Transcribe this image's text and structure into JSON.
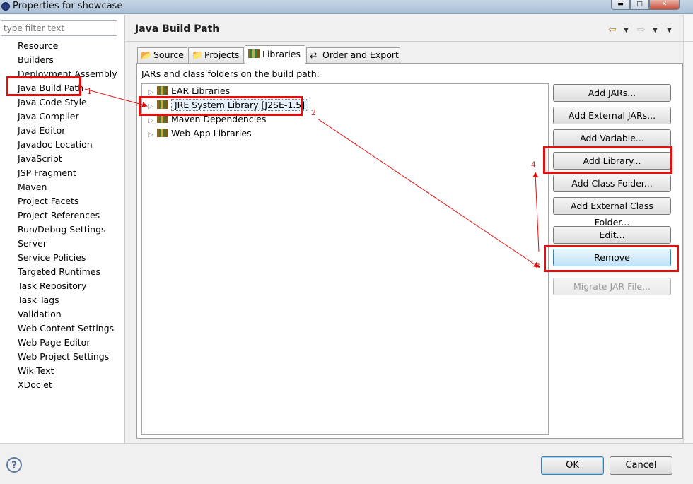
{
  "window": {
    "title": "Properties for showcase",
    "controls": [
      "minimize",
      "maximize",
      "close"
    ]
  },
  "filter": {
    "placeholder": "type filter text"
  },
  "nav_items": [
    "Resource",
    "Builders",
    "Deployment Assembly",
    "Java Build Path",
    "Java Code Style",
    "Java Compiler",
    "Java Editor",
    "Javadoc Location",
    "JavaScript",
    "JSP Fragment",
    "Maven",
    "Project Facets",
    "Project References",
    "Run/Debug Settings",
    "Server",
    "Service Policies",
    "Targeted Runtimes",
    "Task Repository",
    "Task Tags",
    "Validation",
    "Web Content Settings",
    "Web Page Editor",
    "Web Project Settings",
    "WikiText",
    "XDoclet"
  ],
  "selected_nav": "Java Build Path",
  "page_title": "Java Build Path",
  "tabs": [
    "Source",
    "Projects",
    "Libraries",
    "Order and Export"
  ],
  "active_tab": "Libraries",
  "section_label": "JARs and class folders on the build path:",
  "tree_items": [
    "EAR Libraries",
    "JRE System Library [J2SE-1.5]",
    "Maven Dependencies",
    "Web App Libraries"
  ],
  "selected_tree_item": "JRE System Library [J2SE-1.5]",
  "buttons": {
    "add_jars": "Add JARs...",
    "add_external_jars": "Add External JARs...",
    "add_variable": "Add Variable...",
    "add_library": "Add Library...",
    "add_class_folder": "Add Class Folder...",
    "add_external_class_folder": "Add External Class Folder...",
    "edit": "Edit...",
    "remove": "Remove",
    "migrate_jar": "Migrate JAR File..."
  },
  "dialog": {
    "ok": "OK",
    "cancel": "Cancel",
    "help": "?"
  },
  "annotations": {
    "n1": "1",
    "n2": "2",
    "n3": "3",
    "n4": "4",
    "color": "#e01010"
  },
  "icons": {
    "back": "back-arrow-icon",
    "forward": "forward-arrow-icon",
    "menu": "view-menu-icon",
    "help": "help-icon",
    "library": "library-icon"
  }
}
